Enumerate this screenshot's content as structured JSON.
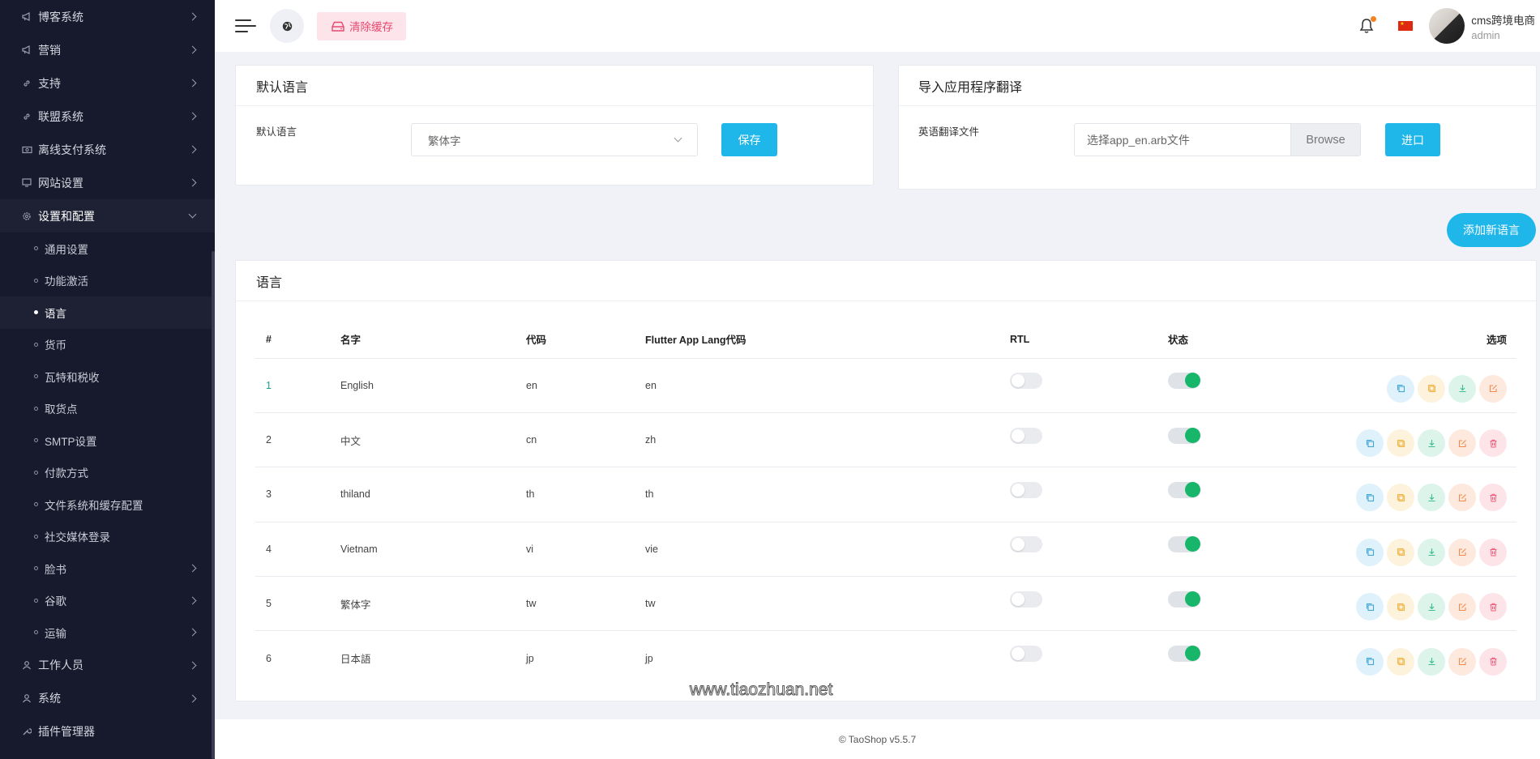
{
  "sidebar": {
    "items_top": [
      {
        "label": "博客系统",
        "icon": "megaphone-icon"
      },
      {
        "label": "营销",
        "icon": "megaphone-icon"
      },
      {
        "label": "支持",
        "icon": "link-icon"
      },
      {
        "label": "联盟系统",
        "icon": "link-icon"
      },
      {
        "label": "离线支付系统",
        "icon": "money-icon"
      },
      {
        "label": "网站设置",
        "icon": "monitor-icon"
      },
      {
        "label": "设置和配置",
        "icon": "gear-icon"
      }
    ],
    "sub_items": [
      {
        "label": "通用设置"
      },
      {
        "label": "功能激活"
      },
      {
        "label": "语言"
      },
      {
        "label": "货币"
      },
      {
        "label": "瓦特和税收"
      },
      {
        "label": "取货点"
      },
      {
        "label": "SMTP设置"
      },
      {
        "label": "付款方式"
      },
      {
        "label": "文件系统和缓存配置"
      },
      {
        "label": "社交媒体登录"
      },
      {
        "label": "脸书"
      },
      {
        "label": "谷歌"
      },
      {
        "label": "运输"
      }
    ],
    "items_bottom": [
      {
        "label": "工作人员",
        "icon": "user-icon"
      },
      {
        "label": "系统",
        "icon": "user-icon"
      },
      {
        "label": "插件管理器",
        "icon": "wrench-icon"
      }
    ]
  },
  "topbar": {
    "clear_cache_label": "清除缓存",
    "user_name": "cms跨境电商",
    "user_role": "admin",
    "notification_color": "#f58120"
  },
  "default_language_card": {
    "title": "默认语言",
    "field_label": "默认语言",
    "selected": "繁体字",
    "save_label": "保存"
  },
  "import_card": {
    "title": "导入应用程序翻译",
    "field_label": "英语翻译文件",
    "file_placeholder": "选择app_en.arb文件",
    "browse_label": "Browse",
    "import_label": "进口"
  },
  "add_language_label": "添加新语言",
  "languages_card": {
    "title": "语言",
    "columns": [
      "#",
      "名字",
      "代码",
      "Flutter App Lang代码",
      "RTL",
      "状态",
      "选项"
    ],
    "rows": [
      {
        "num": "1",
        "name": "English",
        "code": "en",
        "flutter": "en",
        "rtl": false,
        "status": true,
        "deletable": false
      },
      {
        "num": "2",
        "name": "中文",
        "code": "cn",
        "flutter": "zh",
        "rtl": false,
        "status": true,
        "deletable": true
      },
      {
        "num": "3",
        "name": "thiland",
        "code": "th",
        "flutter": "th",
        "rtl": false,
        "status": true,
        "deletable": true
      },
      {
        "num": "4",
        "name": "Vietnam",
        "code": "vi",
        "flutter": "vie",
        "rtl": false,
        "status": true,
        "deletable": true
      },
      {
        "num": "5",
        "name": "繁体字",
        "code": "tw",
        "flutter": "tw",
        "rtl": false,
        "status": true,
        "deletable": true
      },
      {
        "num": "6",
        "name": "日本語",
        "code": "jp",
        "flutter": "jp",
        "rtl": false,
        "status": true,
        "deletable": true
      }
    ]
  },
  "watermark": "www.tiaozhuan.net",
  "footer": "© TaoShop v5.5.7",
  "colors": {
    "accent": "#1fb6ea",
    "sidebar_bg": "#171a2c",
    "status_on": "#18b66a",
    "danger": "#e8496e"
  }
}
